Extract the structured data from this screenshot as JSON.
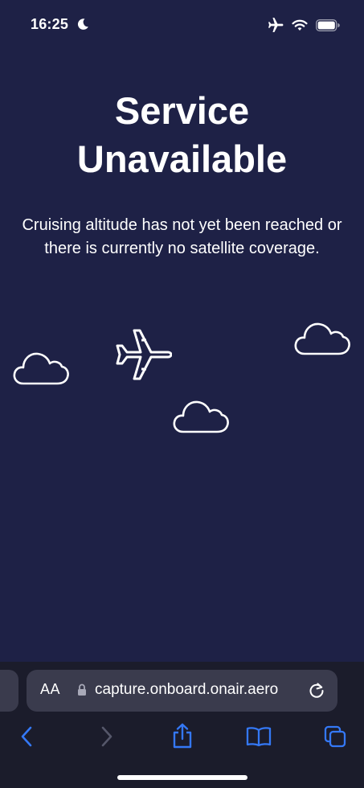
{
  "status_bar": {
    "time": "16:25",
    "icons": [
      "moon-icon",
      "airplane-mode-icon",
      "wifi-icon",
      "battery-icon"
    ]
  },
  "page": {
    "title": "Service Unavailable",
    "message": "Cruising altitude has not yet been reached or there is currently no satellite coverage.",
    "illustration": [
      "cloud-icon",
      "airplane-icon",
      "cloud-icon",
      "cloud-icon"
    ]
  },
  "browser": {
    "text_size_label": "AA",
    "url": "capture.onboard.onair.aero",
    "toolbar": [
      "back-icon",
      "forward-icon",
      "share-icon",
      "bookmarks-icon",
      "tabs-icon"
    ],
    "forward_enabled": false
  },
  "colors": {
    "background": "#1e2146",
    "toolbar": "#1b1c2b",
    "address_bar": "#3a3b4d",
    "accent": "#3478f6",
    "text": "#ffffff"
  }
}
